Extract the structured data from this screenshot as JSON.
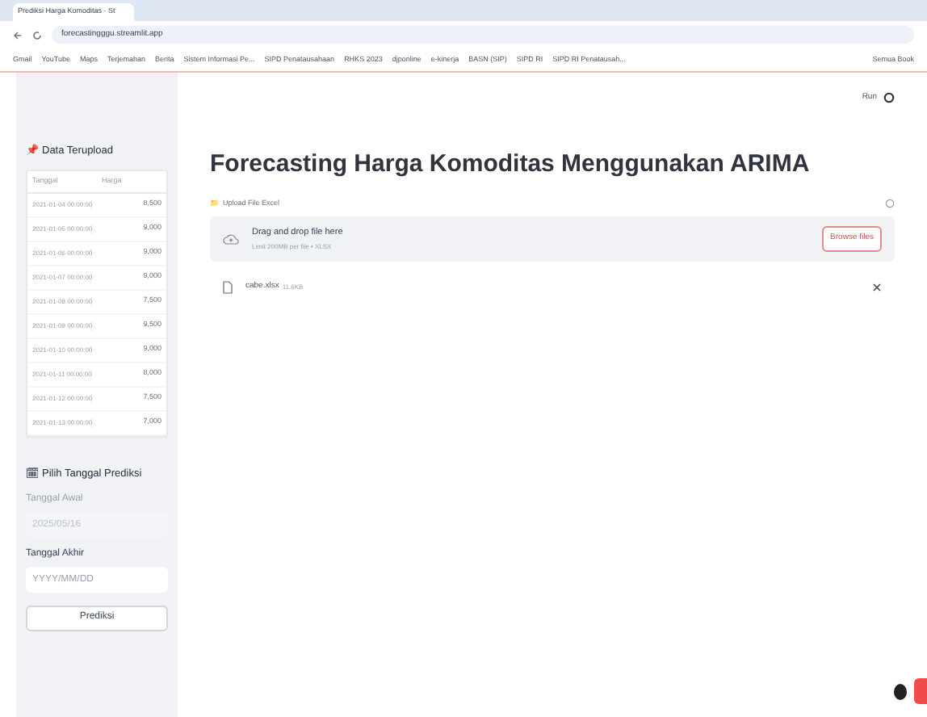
{
  "browser": {
    "tab_title": "Prediksi Harga Komoditas · St",
    "url": "forecastingggu.streamlit.app",
    "bookmarks": [
      "Gmail",
      "YouTube",
      "Maps",
      "Terjemahan",
      "Berita",
      "Sistem Informasi Pe...",
      "SIPD Penatausahaan",
      "RHKS 2023",
      "djponline",
      "e-kinerja",
      "BASN (SIP)",
      "SIPD RI",
      "SIPD RI Penatausah..."
    ],
    "all_bookmarks": "Semua Book"
  },
  "header": {
    "menu_label": "Run"
  },
  "sidebar": {
    "data_icon": "📌",
    "data_heading": "Data Terupload",
    "table": {
      "columns": [
        "Tanggal",
        "Harga"
      ],
      "rows": [
        [
          "2021-01-04 00:00:00",
          "8,500"
        ],
        [
          "2021-01-05 00:00:00",
          "9,000"
        ],
        [
          "2021-01-06 00:00:00",
          "9,000"
        ],
        [
          "2021-01-07 00:00:00",
          "9,000"
        ],
        [
          "2021-01-08 00:00:00",
          "7,500"
        ],
        [
          "2021-01-09 00:00:00",
          "9,500"
        ],
        [
          "2021-01-10 00:00:00",
          "9,000"
        ],
        [
          "2021-01-11 00:00:00",
          "8,000"
        ],
        [
          "2021-01-12 00:00:00",
          "7,500"
        ],
        [
          "2021-01-13 00:00:00",
          "7,000"
        ]
      ]
    },
    "predict_icon": "🗓",
    "predict_heading": "Pilih Tanggal Prediksi",
    "fields": [
      {
        "label": "Tanggal Awal",
        "value": "2025/05/16",
        "disabled": true
      },
      {
        "label": "Tanggal Akhir",
        "placeholder": "YYYY/MM/DD",
        "disabled": false
      }
    ],
    "button": "Prediksi"
  },
  "main": {
    "title": "Forecasting Harga Komoditas Menggunakan ARIMA",
    "upload_icon": "📁",
    "upload_label": "Upload File Excel",
    "dropzone": {
      "text": "Drag and drop file here",
      "limit": "Limit 200MB per file • XLSX",
      "button": "Browse files"
    },
    "file": {
      "name": "cabe.xlsx",
      "size": "11.6KB"
    }
  }
}
